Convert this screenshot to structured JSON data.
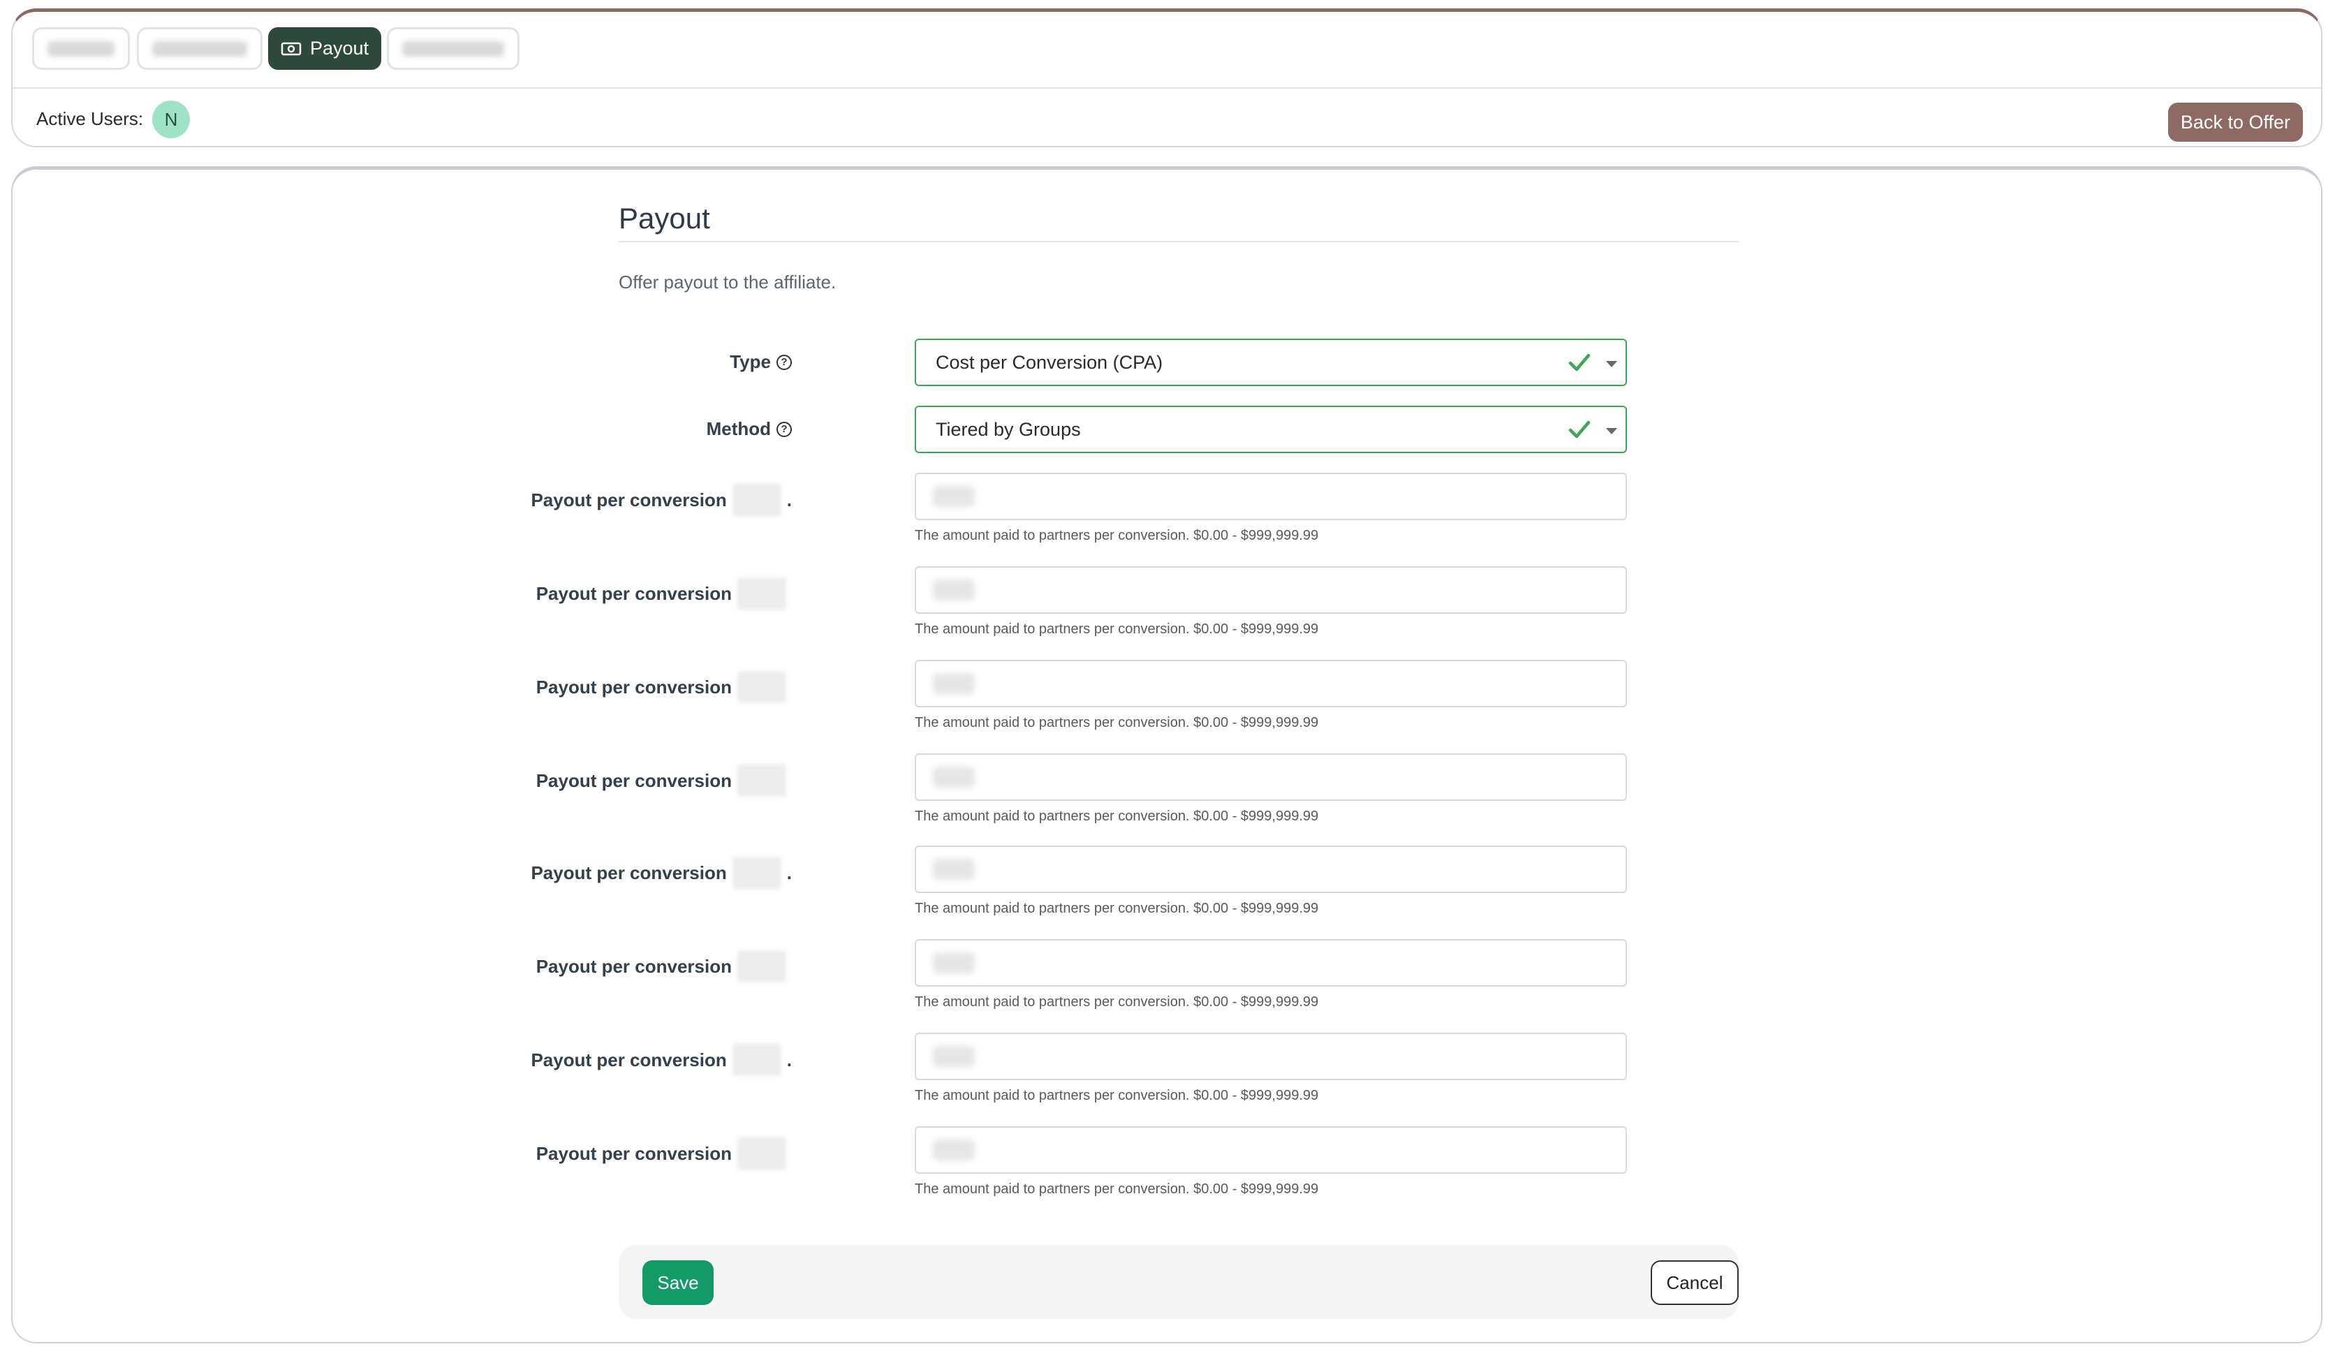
{
  "tabs": [
    {
      "label": "",
      "active": false,
      "icon": "blurred-icon"
    },
    {
      "label": "",
      "active": false,
      "icon": "blurred-icon"
    },
    {
      "label": "Payout",
      "active": true,
      "icon": "money-icon"
    },
    {
      "label": "",
      "active": false,
      "icon": "blurred-icon"
    }
  ],
  "header": {
    "active_users_label": "Active Users:",
    "avatar_initial": "N",
    "back_button": "Back to Offer"
  },
  "section": {
    "title": "Payout",
    "description": "Offer payout to the affiliate."
  },
  "type_field": {
    "label": "Type",
    "value": "Cost per Conversion (CPA)"
  },
  "method_field": {
    "label": "Method",
    "value": "Tiered by Groups"
  },
  "payout_rows": [
    {
      "label": "Payout per conversion",
      "suffix": ".",
      "hint": "The amount paid to partners per conversion. $0.00 - $999,999.99"
    },
    {
      "label": "Payout per conversion",
      "suffix": "",
      "hint": "The amount paid to partners per conversion. $0.00 - $999,999.99"
    },
    {
      "label": "Payout per conversion",
      "suffix": "",
      "hint": "The amount paid to partners per conversion. $0.00 - $999,999.99"
    },
    {
      "label": "Payout per conversion",
      "suffix": "",
      "hint": "The amount paid to partners per conversion. $0.00 - $999,999.99"
    },
    {
      "label": "Payout per conversion",
      "suffix": ".",
      "hint": "The amount paid to partners per conversion. $0.00 - $999,999.99"
    },
    {
      "label": "Payout per conversion",
      "suffix": "",
      "hint": "The amount paid to partners per conversion. $0.00 - $999,999.99"
    },
    {
      "label": "Payout per conversion",
      "suffix": ".",
      "hint": "The amount paid to partners per conversion. $0.00 - $999,999.99"
    },
    {
      "label": "Payout per conversion",
      "suffix": "",
      "hint": "The amount paid to partners per conversion. $0.00 - $999,999.99"
    }
  ],
  "footer": {
    "save_label": "Save",
    "cancel_label": "Cancel"
  },
  "colors": {
    "active_tab": "#2e4a3c",
    "back_button": "#8f6a64",
    "save_button": "#149a66",
    "valid_border": "#3ea655",
    "avatar_bg": "#9ee3c5"
  }
}
